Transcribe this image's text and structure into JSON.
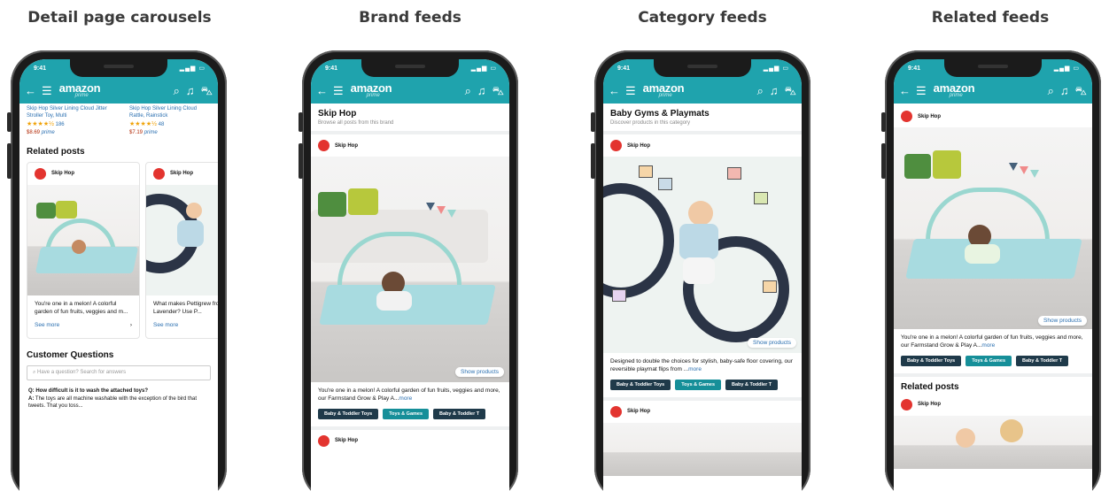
{
  "headings": {
    "col1": "Detail page carousels",
    "col2": "Brand feeds",
    "col3": "Category feeds",
    "col4": "Related feeds"
  },
  "app": {
    "time": "9:41",
    "logo_main": "amazon",
    "logo_sub": "prime",
    "accent": "#1fa3ad"
  },
  "detail": {
    "products": [
      {
        "name": "Skip Hop Silver Lining Cloud Jitter Stroller Toy, Multi",
        "reviews": "186",
        "price": "$8.69",
        "badge": "prime"
      },
      {
        "name": "Skip Hop Silver Lining Cloud Rattle, Rainstick",
        "reviews": "48",
        "price": "$7.19",
        "badge": "prime"
      }
    ],
    "related_title": "Related posts",
    "post1": {
      "brand": "Skip Hop",
      "text": "You're one in a melon! A colorful garden of fun fruits, veggies and m...",
      "see_more": "See more"
    },
    "post2": {
      "brand": "Skip Hop",
      "text": "What makes Pettigrew from Lavender? Use P...",
      "see_more": "See more"
    },
    "questions_title": "Customer Questions",
    "search_placeholder": "Have a question? Search for answers",
    "q_label": "Q:",
    "question": "How difficult is it to wash the attached toys?",
    "a_label": "A:",
    "answer": "The toys are all machine washable with the exception of the bird that tweets. That you toss..."
  },
  "brand": {
    "title": "Skip Hop",
    "subtitle": "Browse all posts from this brand",
    "brand_name": "Skip Hop",
    "show_products": "Show products",
    "desc": "You're one in a melon! A colorful garden of fun fruits, veggies and more, our Farmstand Grow & Play A...",
    "more": "more",
    "tags": [
      "Baby & Toddler Toys",
      "Toys & Games",
      "Baby & Toddler T"
    ],
    "next_brand": "Skip Hop"
  },
  "category": {
    "title": "Baby Gyms & Playmats",
    "subtitle": "Discover products in this category",
    "brand_name": "Skip Hop",
    "show_products": "Show products",
    "desc": "Designed to double the choices for stylish, baby-safe floor covering, our reversible playmat flips from ...",
    "more": "more",
    "tags": [
      "Baby & Toddler Toys",
      "Toys & Games",
      "Baby & Toddler T"
    ],
    "next_brand": "Skip Hop"
  },
  "related": {
    "brand_name": "Skip Hop",
    "show_products": "Show products",
    "desc": "You're one in a melon! A colorful garden of fun fruits, veggies and more, our Farmstand Grow & Play A...",
    "more": "more",
    "tags": [
      "Baby & Toddler Toys",
      "Toys & Games",
      "Baby & Toddler T"
    ],
    "related_title": "Related posts",
    "next_brand": "Skip Hop"
  }
}
